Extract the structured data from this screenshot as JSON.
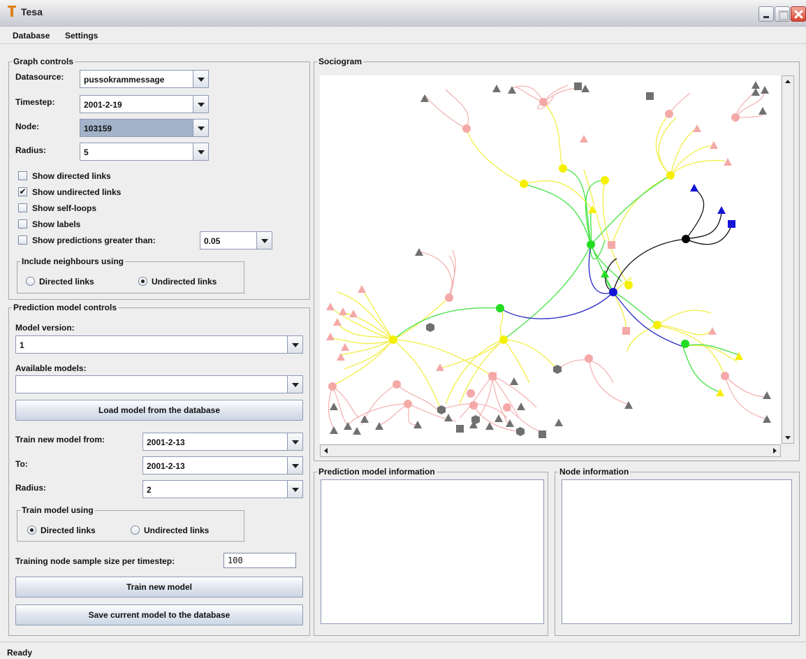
{
  "window": {
    "title": "Tesa"
  },
  "menu": [
    "Database",
    "Settings"
  ],
  "graph_controls": {
    "title": "Graph controls",
    "datasource_label": "Datasource:",
    "datasource_value": "pussokrammessage",
    "timestep_label": "Timestep:",
    "timestep_value": "2001-2-19",
    "node_label": "Node:",
    "node_value": "103159",
    "radius_label": "Radius:",
    "radius_value": "5",
    "checkboxes": [
      {
        "label": "Show directed links",
        "checked": false
      },
      {
        "label": "Show undirected links",
        "checked": true
      },
      {
        "label": "Show self-loops",
        "checked": false
      },
      {
        "label": "Show labels",
        "checked": false
      },
      {
        "label": "Show predictions greater than:",
        "checked": false
      }
    ],
    "prediction_threshold": "0.05",
    "neighbours_group": "Include neighbours using",
    "neighbours_options": [
      {
        "label": "Directed links",
        "selected": false
      },
      {
        "label": "Undirected links",
        "selected": true
      }
    ]
  },
  "prediction_controls": {
    "title": "Prediction model controls",
    "model_version_label": "Model version:",
    "model_version_value": "1",
    "available_models_label": "Available models:",
    "available_models_value": "",
    "load_button": "Load model from the database",
    "train_from_label": "Train new model from:",
    "train_from_value": "2001-2-13",
    "to_label": "To:",
    "to_value": "2001-2-13",
    "radius_label": "Radius:",
    "radius_value": "2",
    "train_using_group": "Train model using",
    "train_using_options": [
      {
        "label": "Directed links",
        "selected": true
      },
      {
        "label": "Undirected links",
        "selected": false
      }
    ],
    "sample_size_label": "Training node sample size per timestep:",
    "sample_size_value": "100",
    "train_button": "Train new model",
    "save_button": "Save current model to the database"
  },
  "sociogram": {
    "title": "Sociogram"
  },
  "prediction_info": {
    "title": "Prediction model information"
  },
  "node_info": {
    "title": "Node information"
  },
  "status": "Ready",
  "colors": {
    "node_pink": "#f4a9a8",
    "node_gray": "#707070",
    "node_yellow": "#f5ef00",
    "node_green": "#22dd22",
    "node_blue": "#1414d6",
    "node_black": "#000000",
    "edge_pink": "#f4b4b4",
    "edge_yellow": "#f3ee45",
    "edge_green": "#3fe33f",
    "edge_blue": "#2424c8",
    "edge_black": "#111111"
  }
}
